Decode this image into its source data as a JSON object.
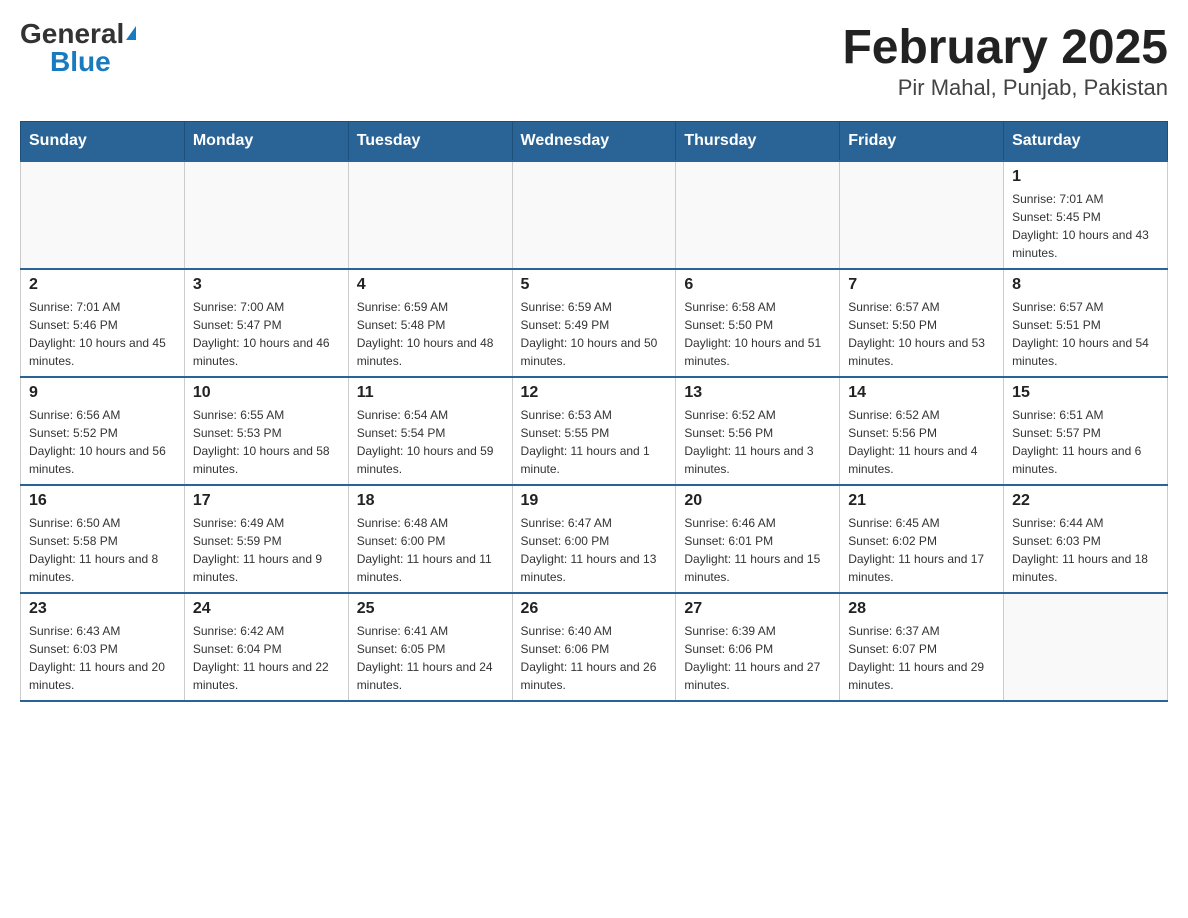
{
  "header": {
    "logo_general": "General",
    "logo_blue": "Blue",
    "month_title": "February 2025",
    "location": "Pir Mahal, Punjab, Pakistan"
  },
  "days_of_week": [
    "Sunday",
    "Monday",
    "Tuesday",
    "Wednesday",
    "Thursday",
    "Friday",
    "Saturday"
  ],
  "weeks": [
    {
      "days": [
        {
          "number": "",
          "info": ""
        },
        {
          "number": "",
          "info": ""
        },
        {
          "number": "",
          "info": ""
        },
        {
          "number": "",
          "info": ""
        },
        {
          "number": "",
          "info": ""
        },
        {
          "number": "",
          "info": ""
        },
        {
          "number": "1",
          "info": "Sunrise: 7:01 AM\nSunset: 5:45 PM\nDaylight: 10 hours and 43 minutes."
        }
      ]
    },
    {
      "days": [
        {
          "number": "2",
          "info": "Sunrise: 7:01 AM\nSunset: 5:46 PM\nDaylight: 10 hours and 45 minutes."
        },
        {
          "number": "3",
          "info": "Sunrise: 7:00 AM\nSunset: 5:47 PM\nDaylight: 10 hours and 46 minutes."
        },
        {
          "number": "4",
          "info": "Sunrise: 6:59 AM\nSunset: 5:48 PM\nDaylight: 10 hours and 48 minutes."
        },
        {
          "number": "5",
          "info": "Sunrise: 6:59 AM\nSunset: 5:49 PM\nDaylight: 10 hours and 50 minutes."
        },
        {
          "number": "6",
          "info": "Sunrise: 6:58 AM\nSunset: 5:50 PM\nDaylight: 10 hours and 51 minutes."
        },
        {
          "number": "7",
          "info": "Sunrise: 6:57 AM\nSunset: 5:50 PM\nDaylight: 10 hours and 53 minutes."
        },
        {
          "number": "8",
          "info": "Sunrise: 6:57 AM\nSunset: 5:51 PM\nDaylight: 10 hours and 54 minutes."
        }
      ]
    },
    {
      "days": [
        {
          "number": "9",
          "info": "Sunrise: 6:56 AM\nSunset: 5:52 PM\nDaylight: 10 hours and 56 minutes."
        },
        {
          "number": "10",
          "info": "Sunrise: 6:55 AM\nSunset: 5:53 PM\nDaylight: 10 hours and 58 minutes."
        },
        {
          "number": "11",
          "info": "Sunrise: 6:54 AM\nSunset: 5:54 PM\nDaylight: 10 hours and 59 minutes."
        },
        {
          "number": "12",
          "info": "Sunrise: 6:53 AM\nSunset: 5:55 PM\nDaylight: 11 hours and 1 minute."
        },
        {
          "number": "13",
          "info": "Sunrise: 6:52 AM\nSunset: 5:56 PM\nDaylight: 11 hours and 3 minutes."
        },
        {
          "number": "14",
          "info": "Sunrise: 6:52 AM\nSunset: 5:56 PM\nDaylight: 11 hours and 4 minutes."
        },
        {
          "number": "15",
          "info": "Sunrise: 6:51 AM\nSunset: 5:57 PM\nDaylight: 11 hours and 6 minutes."
        }
      ]
    },
    {
      "days": [
        {
          "number": "16",
          "info": "Sunrise: 6:50 AM\nSunset: 5:58 PM\nDaylight: 11 hours and 8 minutes."
        },
        {
          "number": "17",
          "info": "Sunrise: 6:49 AM\nSunset: 5:59 PM\nDaylight: 11 hours and 9 minutes."
        },
        {
          "number": "18",
          "info": "Sunrise: 6:48 AM\nSunset: 6:00 PM\nDaylight: 11 hours and 11 minutes."
        },
        {
          "number": "19",
          "info": "Sunrise: 6:47 AM\nSunset: 6:00 PM\nDaylight: 11 hours and 13 minutes."
        },
        {
          "number": "20",
          "info": "Sunrise: 6:46 AM\nSunset: 6:01 PM\nDaylight: 11 hours and 15 minutes."
        },
        {
          "number": "21",
          "info": "Sunrise: 6:45 AM\nSunset: 6:02 PM\nDaylight: 11 hours and 17 minutes."
        },
        {
          "number": "22",
          "info": "Sunrise: 6:44 AM\nSunset: 6:03 PM\nDaylight: 11 hours and 18 minutes."
        }
      ]
    },
    {
      "days": [
        {
          "number": "23",
          "info": "Sunrise: 6:43 AM\nSunset: 6:03 PM\nDaylight: 11 hours and 20 minutes."
        },
        {
          "number": "24",
          "info": "Sunrise: 6:42 AM\nSunset: 6:04 PM\nDaylight: 11 hours and 22 minutes."
        },
        {
          "number": "25",
          "info": "Sunrise: 6:41 AM\nSunset: 6:05 PM\nDaylight: 11 hours and 24 minutes."
        },
        {
          "number": "26",
          "info": "Sunrise: 6:40 AM\nSunset: 6:06 PM\nDaylight: 11 hours and 26 minutes."
        },
        {
          "number": "27",
          "info": "Sunrise: 6:39 AM\nSunset: 6:06 PM\nDaylight: 11 hours and 27 minutes."
        },
        {
          "number": "28",
          "info": "Sunrise: 6:37 AM\nSunset: 6:07 PM\nDaylight: 11 hours and 29 minutes."
        },
        {
          "number": "",
          "info": ""
        }
      ]
    }
  ]
}
